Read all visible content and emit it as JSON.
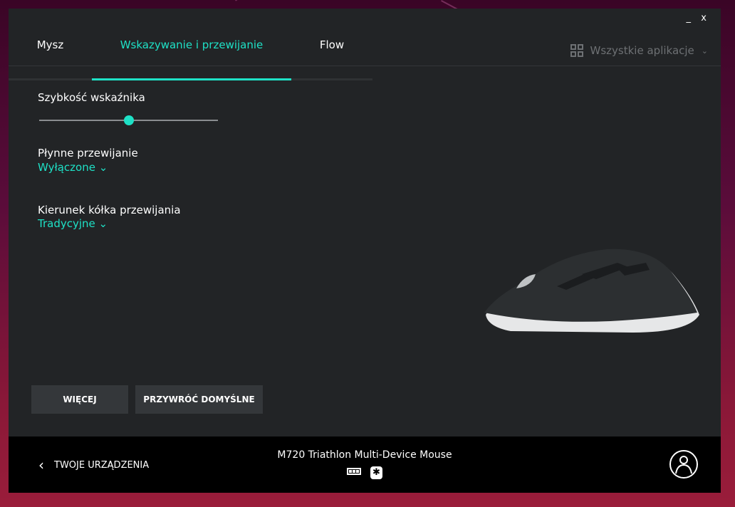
{
  "window": {
    "minimize_label": "_",
    "close_label": "x"
  },
  "tabs": [
    {
      "label": "Mysz"
    },
    {
      "label": "Wskazywanie i przewijanie",
      "active": true
    },
    {
      "label": "Flow"
    }
  ],
  "app_selector": {
    "label": "Wszystkie aplikacje",
    "icon": "grid-icon"
  },
  "settings": {
    "pointer_speed": {
      "label": "Szybkość wskaźnika",
      "value_percent": 50
    },
    "smooth_scrolling": {
      "label": "Płynne przewijanie",
      "value": "Wyłączone"
    },
    "scroll_direction": {
      "label": "Kierunek kółka przewijania",
      "value": "Tradycyjne"
    }
  },
  "buttons": {
    "more": "WIĘCEJ",
    "restore": "PRZYWRÓĆ DOMYŚLNE"
  },
  "footer": {
    "back_label": "TWOJE URZĄDZENIA",
    "device_name": "M720 Triathlon Multi-Device Mouse",
    "icons": [
      "battery-icon",
      "unifying-receiver-icon",
      "account-icon"
    ]
  },
  "colors": {
    "accent": "#1ee1c6",
    "window": "#222426",
    "footer": "#000000"
  }
}
